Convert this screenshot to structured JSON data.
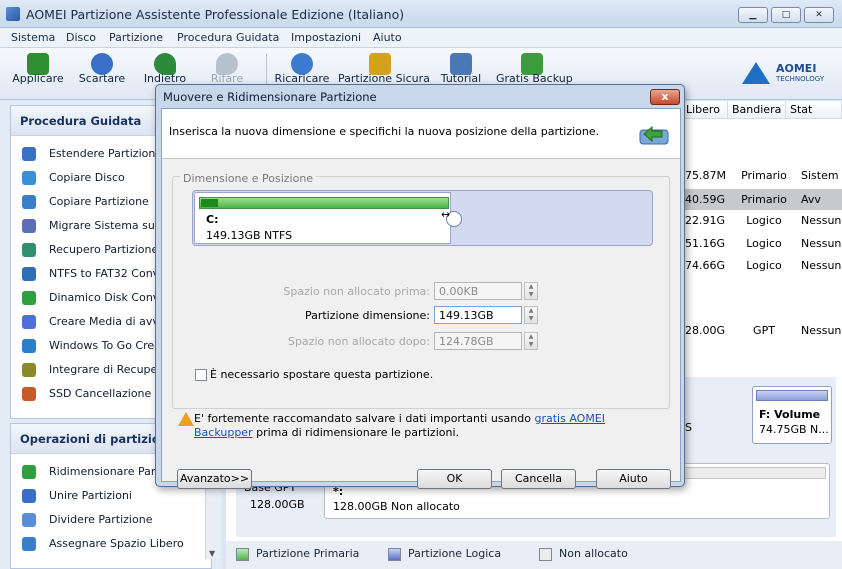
{
  "app": {
    "title": "AOMEI Partizione Assistente Professionale Edizione (Italiano)"
  },
  "menu": [
    "Sistema",
    "Disco",
    "Partizione",
    "Procedura Guidata",
    "Impostazioni",
    "Aiuto"
  ],
  "toolbar": {
    "items": [
      {
        "label": "Applicare",
        "icon": "apply-check-icon",
        "color": "#2f8f2f"
      },
      {
        "label": "Scartare",
        "icon": "discard-icon",
        "color": "#3a6fc8"
      },
      {
        "label": "Indietro",
        "icon": "undo-arrow-icon",
        "color": "#2d8a3a"
      },
      {
        "label": "Rifare",
        "icon": "redo-arrow-icon",
        "color": "#b8c2cf"
      },
      {
        "label": "Ricaricare",
        "icon": "reload-icon",
        "color": "#3b7bd0"
      },
      {
        "label": "Partizione Sicura",
        "icon": "shield-icon",
        "color": "#d4a21a"
      },
      {
        "label": "Tutorial",
        "icon": "tutorial-icon",
        "color": "#4b79b8"
      },
      {
        "label": "Gratis Backup",
        "icon": "backup-icon",
        "color": "#3c9b3c"
      }
    ],
    "logo": "AOMEI",
    "logo_sub": "TECHNOLOGY"
  },
  "wizard": {
    "title": "Procedura Guidata",
    "items": [
      "Estendere Partizione",
      "Copiare Disco",
      "Copiare Partizione",
      "Migrare Sistema su SS",
      "Recupero Partizione",
      "NTFS to FAT32 Conve",
      "Dinamico Disk Convert",
      "Creare Media di avvio",
      "Windows To Go Creat",
      "Integrare di Recupero",
      "SSD Cancellazione Sicu"
    ]
  },
  "operations": {
    "title": "Operazioni di partizione",
    "items": [
      "Ridimensionare Partizi",
      "Unire Partizioni",
      "Dividere Partizione",
      "Assegnare Spazio Libero"
    ]
  },
  "table": {
    "headers": [
      "Libero",
      "Bandiera",
      "Stat"
    ],
    "rows": [
      {
        "free": "75.87MB",
        "flag": "Primario",
        "status": "Sistem"
      },
      {
        "free": "40.59GB",
        "flag": "Primario",
        "status": "Avv"
      },
      {
        "free": "22.91GB",
        "flag": "Logico",
        "status": "Nessun"
      },
      {
        "free": "51.16GB",
        "flag": "Logico",
        "status": "Nessun"
      },
      {
        "free": "74.66GB",
        "flag": "Logico",
        "status": "Nessun"
      },
      {
        "free": "28.00GB",
        "flag": "GPT",
        "status": "Nessun"
      }
    ]
  },
  "disks": {
    "f_name": "F: Volume",
    "f_size": "74.75GB N...",
    "s_label": "S",
    "gpt_label": "Base GPT",
    "gpt_size": "128.00GB",
    "unalloc_name": "*:",
    "unalloc_desc": "128.00GB Non allocato"
  },
  "legend": [
    "Partizione Primaria",
    "Partizione Logica",
    "Non allocato"
  ],
  "dialog": {
    "title": "Muovere e Ridimensionare Partizione",
    "close": "x",
    "intro": "Inserisca la nuova dimensione e specifichi la nuova posizione della partizione.",
    "group_label": "Dimensione e Posizione",
    "partition_name": "C:",
    "partition_size": "149.13GB NTFS",
    "used_fraction": 0.07,
    "fields": [
      {
        "label": "Spazio non allocato prima:",
        "value": "0.00KB",
        "enabled": false
      },
      {
        "label": "Partizione dimensione:",
        "value": "149.13GB",
        "enabled": true
      },
      {
        "label": "Spazio non allocato dopo:",
        "value": "124.78GB",
        "enabled": false
      }
    ],
    "checkbox": "È necessario spostare questa partizione.",
    "warning_pre": "E' fortemente raccomandato salvare i dati importanti usando ",
    "warning_link": "gratis AOMEI Backupper",
    "warning_post": " prima di ridimensionare le partizioni.",
    "buttons": {
      "advanced": "Avanzato>>",
      "ok": "OK",
      "cancel": "Cancella",
      "help": "Aiuto"
    }
  }
}
